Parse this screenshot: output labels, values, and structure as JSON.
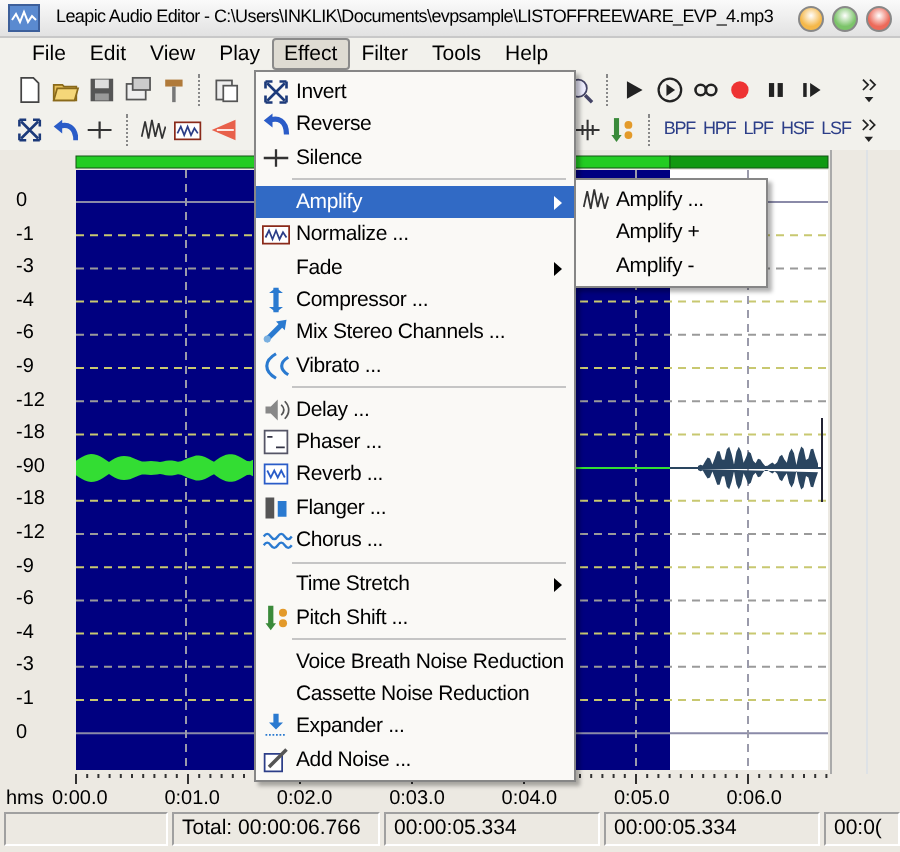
{
  "window": {
    "title": "Leapic Audio Editor - C:\\Users\\INKLIK\\Documents\\evpsample\\LISTOFFREEWARE_EVP_4.mp3"
  },
  "menu": [
    {
      "label": "File",
      "selected": false
    },
    {
      "label": "Edit",
      "selected": false
    },
    {
      "label": "View",
      "selected": false
    },
    {
      "label": "Play",
      "selected": false
    },
    {
      "label": "Effect",
      "selected": true
    },
    {
      "label": "Filter",
      "selected": false
    },
    {
      "label": "Tools",
      "selected": false
    },
    {
      "label": "Help",
      "selected": false
    }
  ],
  "filter_buttons": [
    "BPF",
    "HPF",
    "LPF",
    "HSF",
    "LSF"
  ],
  "effect_menu": [
    {
      "kind": "item",
      "label": "Invert",
      "selected": false
    },
    {
      "kind": "item",
      "label": "Reverse",
      "selected": false
    },
    {
      "kind": "item",
      "label": "Silence",
      "selected": false
    },
    {
      "kind": "separator"
    },
    {
      "kind": "submenu",
      "label": "Amplify",
      "selected": true
    },
    {
      "kind": "item",
      "label": "Normalize ...",
      "selected": false
    },
    {
      "kind": "submenu",
      "label": "Fade",
      "selected": false
    },
    {
      "kind": "item",
      "label": "Compressor ...",
      "selected": false
    },
    {
      "kind": "item",
      "label": "Mix Stereo Channels ...",
      "selected": false
    },
    {
      "kind": "item",
      "label": "Vibrato ...",
      "selected": false
    },
    {
      "kind": "separator"
    },
    {
      "kind": "item",
      "label": "Delay ...",
      "selected": false
    },
    {
      "kind": "item",
      "label": "Phaser ...",
      "selected": false
    },
    {
      "kind": "item",
      "label": "Reverb ...",
      "selected": false
    },
    {
      "kind": "item",
      "label": "Flanger ...",
      "selected": false
    },
    {
      "kind": "item",
      "label": "Chorus ...",
      "selected": false
    },
    {
      "kind": "separator"
    },
    {
      "kind": "submenu",
      "label": "Time Stretch",
      "selected": false
    },
    {
      "kind": "item",
      "label": "Pitch Shift ...",
      "selected": false
    },
    {
      "kind": "separator"
    },
    {
      "kind": "item",
      "label": "Voice Breath Noise Reduction",
      "selected": false
    },
    {
      "kind": "item",
      "label": "Cassette Noise Reduction",
      "selected": false
    },
    {
      "kind": "item",
      "label": "Expander ...",
      "selected": false
    },
    {
      "kind": "item",
      "label": "Add Noise ...",
      "selected": false
    }
  ],
  "amplify_submenu": [
    {
      "label": "Amplify ..."
    },
    {
      "label": "Amplify +"
    },
    {
      "label": "Amplify -"
    }
  ],
  "level_scale": [
    "0",
    "-1",
    "-3",
    "-4",
    "-6",
    "-9",
    "-12",
    "-18",
    "-90",
    "-18",
    "-12",
    "-9",
    "-6",
    "-4",
    "-3",
    "-1",
    "0"
  ],
  "time_ruler": {
    "unit": "hms",
    "ticks": [
      "0:00.0",
      "0:01.0",
      "0:02.0",
      "0:03.0",
      "0:04.0",
      "0:05.0",
      "0:06.0"
    ]
  },
  "status_bar": [
    "Total: 00:00:06.766",
    "00:00:05.334",
    "00:00:05.334",
    "00:0("
  ]
}
